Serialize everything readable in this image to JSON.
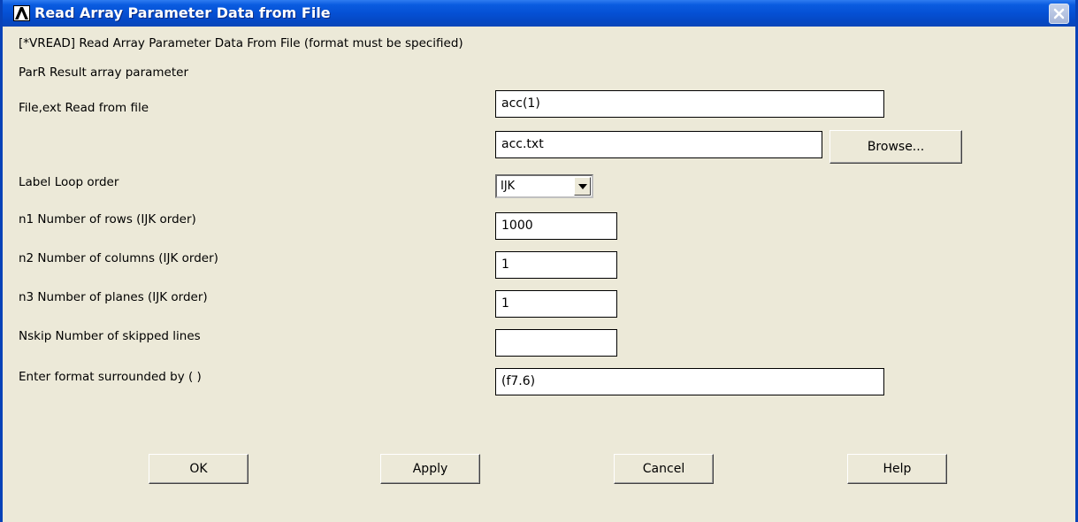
{
  "window": {
    "title": "Read Array Parameter Data from File",
    "accent_color": "#0550d4",
    "background_color": "#ece9d8"
  },
  "icons": {
    "app": "ansys-logo-icon",
    "close": "close-icon",
    "dropdown": "chevron-down-icon"
  },
  "header_text": "[*VREAD]  Read Array Parameter Data From File (format must be specified)",
  "fields": {
    "parr": {
      "label": "ParR   Result array parameter",
      "value": "acc(1)"
    },
    "file": {
      "label": "File,ext   Read from file",
      "value": "acc.txt",
      "browse_label": "Browse..."
    },
    "label": {
      "label": "Label Loop order",
      "value": "IJK"
    },
    "n1": {
      "label": "n1 Number of rows    (IJK order)",
      "value": "1000"
    },
    "n2": {
      "label": "n2 Number of columns (IJK order)",
      "value": "1"
    },
    "n3": {
      "label": "n3 Number of planes  (IJK order)",
      "value": "1"
    },
    "nskip": {
      "label": "Nskip  Number of skipped lines",
      "value": ""
    },
    "format": {
      "label": "Enter format surrounded by ( )",
      "value": "(f7.6)"
    }
  },
  "buttons": {
    "ok": "OK",
    "apply": "Apply",
    "cancel": "Cancel",
    "help": "Help"
  }
}
